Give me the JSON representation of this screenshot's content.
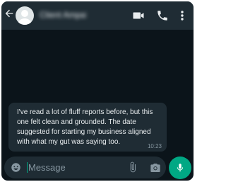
{
  "header": {
    "contact_name": "Client Ampah",
    "icons": {
      "back": "back-arrow-icon",
      "avatar": "avatar",
      "video": "video-call-icon",
      "call": "phone-call-icon",
      "menu": "more-vertical-icon"
    }
  },
  "messages": [
    {
      "text": "I've read a lot of fluff reports before, but this one felt clean and grounded. The date suggested for starting my business aligned with what my gut was saying too.",
      "time": "10:23",
      "direction": "incoming"
    }
  ],
  "composer": {
    "placeholder": "Message",
    "icons": {
      "emoji": "emoji-icon",
      "attach": "paperclip-icon",
      "camera": "camera-icon",
      "mic": "microphone-icon"
    }
  },
  "colors": {
    "background": "#0b141a",
    "header": "#1f2c34",
    "bubble_incoming": "#1f2c34",
    "accent": "#00a884",
    "text_primary": "#e9edef",
    "text_secondary": "#8696a0"
  }
}
